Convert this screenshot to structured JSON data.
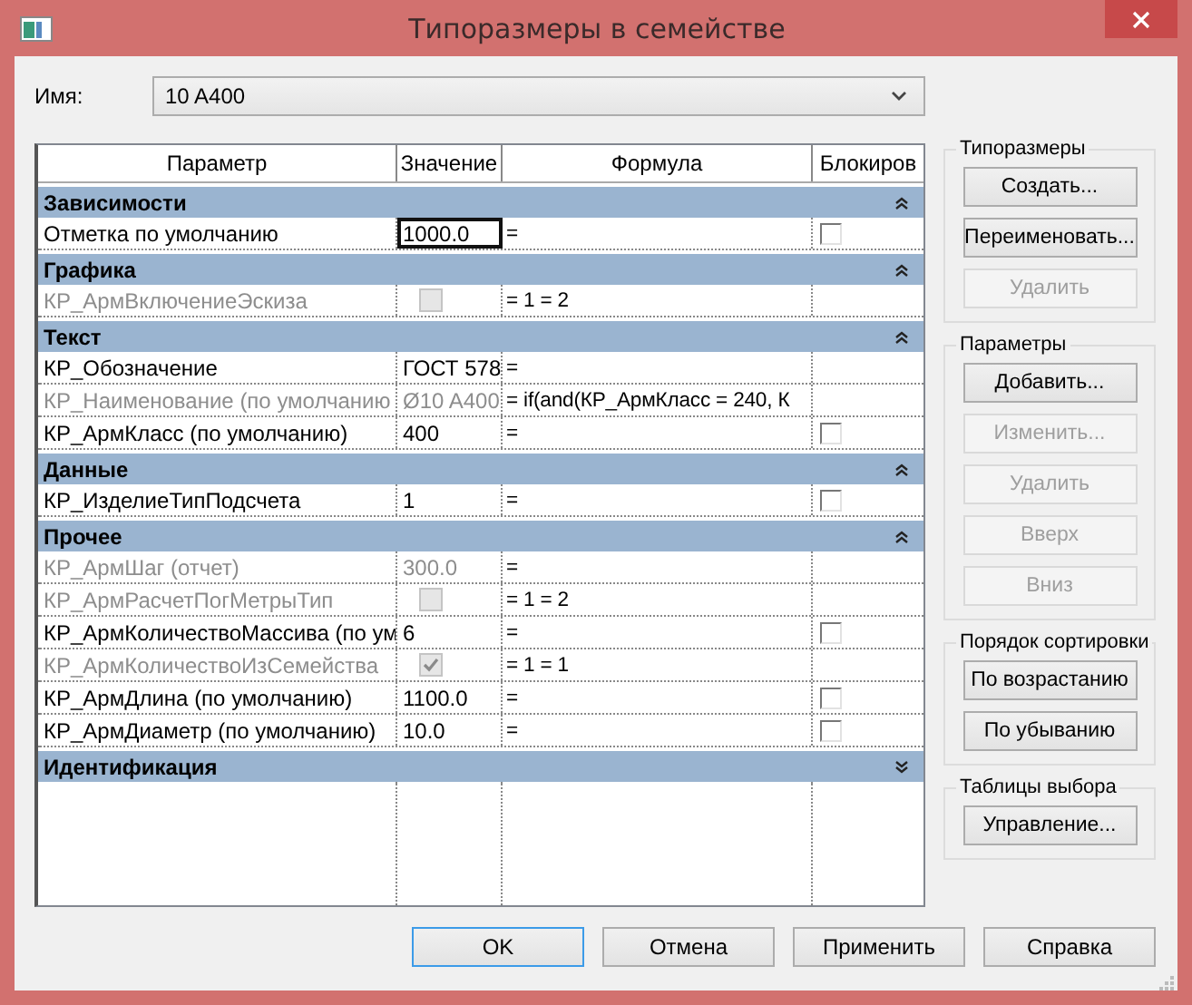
{
  "window": {
    "title": "Типоразмеры в семействе"
  },
  "name_field": {
    "label": "Имя:",
    "value": "10 A400"
  },
  "table": {
    "columns": [
      "Параметр",
      "Значение",
      "Формула",
      "Блокиров"
    ],
    "groups": [
      {
        "title": "Зависимости",
        "expanded": true,
        "params": [
          {
            "name": "Отметка по умолчанию",
            "disabled": false,
            "selected": true,
            "value": {
              "kind": "text",
              "text": "1000.0"
            },
            "formula": "=",
            "lock": {
              "checked": false
            }
          }
        ]
      },
      {
        "title": "Графика",
        "expanded": true,
        "params": [
          {
            "name": "КР_АрмВключениеЭскиза",
            "disabled": true,
            "selected": false,
            "value": {
              "kind": "checkbox",
              "checked": false
            },
            "formula": "= 1 = 2"
          }
        ]
      },
      {
        "title": "Текст",
        "expanded": true,
        "params": [
          {
            "name": "КР_Обозначение",
            "disabled": false,
            "selected": false,
            "value": {
              "kind": "text",
              "text": "ГОСТ 578"
            },
            "formula": "="
          },
          {
            "name": "КР_Наименование (по умолчанию",
            "disabled": true,
            "selected": false,
            "value": {
              "kind": "text",
              "text": "Ø10 A400"
            },
            "formula": "= if(and(КР_АрмКласс = 240, К"
          },
          {
            "name": "КР_АрмКласс (по умолчанию)",
            "disabled": false,
            "selected": false,
            "value": {
              "kind": "text",
              "text": "400"
            },
            "formula": "=",
            "lock": {
              "checked": false
            }
          }
        ]
      },
      {
        "title": "Данные",
        "expanded": true,
        "params": [
          {
            "name": "КР_ИзделиеТипПодсчета",
            "disabled": false,
            "selected": false,
            "value": {
              "kind": "text",
              "text": "1"
            },
            "formula": "=",
            "lock": {
              "checked": false
            }
          }
        ]
      },
      {
        "title": "Прочее",
        "expanded": true,
        "params": [
          {
            "name": "КР_АрмШаг (отчет)",
            "disabled": true,
            "selected": false,
            "value": {
              "kind": "text",
              "text": "300.0"
            },
            "formula": "="
          },
          {
            "name": "КР_АрмРасчетПогМетрыТип",
            "disabled": true,
            "selected": false,
            "value": {
              "kind": "checkbox",
              "checked": false
            },
            "formula": "= 1 = 2"
          },
          {
            "name": "КР_АрмКоличествоМассива (по ум",
            "disabled": false,
            "selected": false,
            "value": {
              "kind": "text",
              "text": "6"
            },
            "formula": "=",
            "lock": {
              "checked": false
            }
          },
          {
            "name": "КР_АрмКоличествоИзСемейства",
            "disabled": true,
            "selected": false,
            "value": {
              "kind": "checkbox",
              "checked": true
            },
            "formula": "= 1 = 1"
          },
          {
            "name": "КР_АрмДлина (по умолчанию)",
            "disabled": false,
            "selected": false,
            "value": {
              "kind": "text",
              "text": "1100.0"
            },
            "formula": "=",
            "lock": {
              "checked": false
            }
          },
          {
            "name": "КР_АрмДиаметр (по умолчанию)",
            "disabled": false,
            "selected": false,
            "value": {
              "kind": "text",
              "text": "10.0"
            },
            "formula": "=",
            "lock": {
              "checked": false
            }
          }
        ]
      },
      {
        "title": "Идентификация",
        "expanded": false
      }
    ]
  },
  "side_panels": [
    {
      "title": "Типоразмеры",
      "buttons": [
        {
          "label": "Создать...",
          "disabled": false
        },
        {
          "label": "Переименовать...",
          "disabled": false
        },
        {
          "label": "Удалить",
          "disabled": true
        }
      ]
    },
    {
      "title": "Параметры",
      "buttons": [
        {
          "label": "Добавить...",
          "disabled": false
        },
        {
          "label": "Изменить...",
          "disabled": true
        },
        {
          "label": "Удалить",
          "disabled": true
        },
        {
          "label": "Вверх",
          "disabled": true
        },
        {
          "label": "Вниз",
          "disabled": true
        }
      ]
    },
    {
      "title": "Порядок сортировки",
      "buttons": [
        {
          "label": "По возрастанию",
          "disabled": false
        },
        {
          "label": "По убыванию",
          "disabled": false
        }
      ]
    },
    {
      "title": "Таблицы выбора",
      "buttons": [
        {
          "label": "Управление...",
          "disabled": false
        }
      ]
    }
  ],
  "footer_buttons": [
    {
      "label": "OK",
      "focused": true
    },
    {
      "label": "Отмена",
      "focused": false
    },
    {
      "label": "Применить",
      "focused": false
    },
    {
      "label": "Справка",
      "focused": false
    }
  ]
}
